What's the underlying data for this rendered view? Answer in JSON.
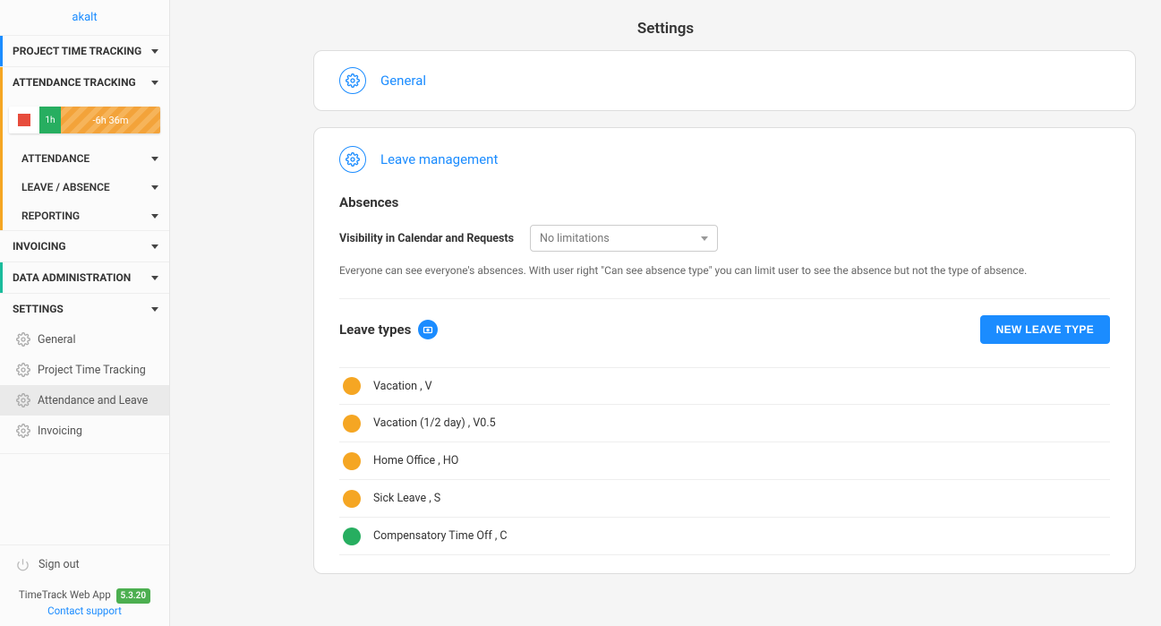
{
  "sidebar": {
    "user_name": "akalt",
    "sections": {
      "project_time": "PROJECT TIME TRACKING",
      "attendance": "ATTENDANCE TRACKING",
      "invoicing": "INVOICING",
      "data_admin": "DATA ADMINISTRATION",
      "settings": "SETTINGS"
    },
    "tracker": {
      "green_label": "1h",
      "rest_label": "-6h 36m"
    },
    "attendance_sub": [
      "ATTENDANCE",
      "LEAVE / ABSENCE",
      "REPORTING"
    ],
    "settings_children": [
      "General",
      "Project Time Tracking",
      "Attendance and Leave",
      "Invoicing"
    ],
    "signout_label": "Sign out",
    "footer_app": "TimeTrack Web App",
    "footer_version": "5.3.20",
    "footer_contact": "Contact support"
  },
  "page": {
    "title": "Settings",
    "card_general_title": "General",
    "card_leave_title": "Leave management",
    "absences": {
      "heading": "Absences",
      "field_label": "Visibility in Calendar and Requests",
      "select_value": "No limitations",
      "hint": "Everyone can see everyone's absences. With user right \"Can see absence type\" you can limit user to see the absence but not the type of absence."
    },
    "leave_types": {
      "heading": "Leave types",
      "button": "NEW LEAVE TYPE",
      "items": [
        {
          "color": "#f5a623",
          "label": "Vacation , V"
        },
        {
          "color": "#f5a623",
          "label": "Vacation (1/2 day) , V0.5"
        },
        {
          "color": "#f5a623",
          "label": "Home Office , HO"
        },
        {
          "color": "#f5a623",
          "label": "Sick Leave , S"
        },
        {
          "color": "#27ae60",
          "label": "Compensatory Time Off , C"
        }
      ]
    }
  }
}
